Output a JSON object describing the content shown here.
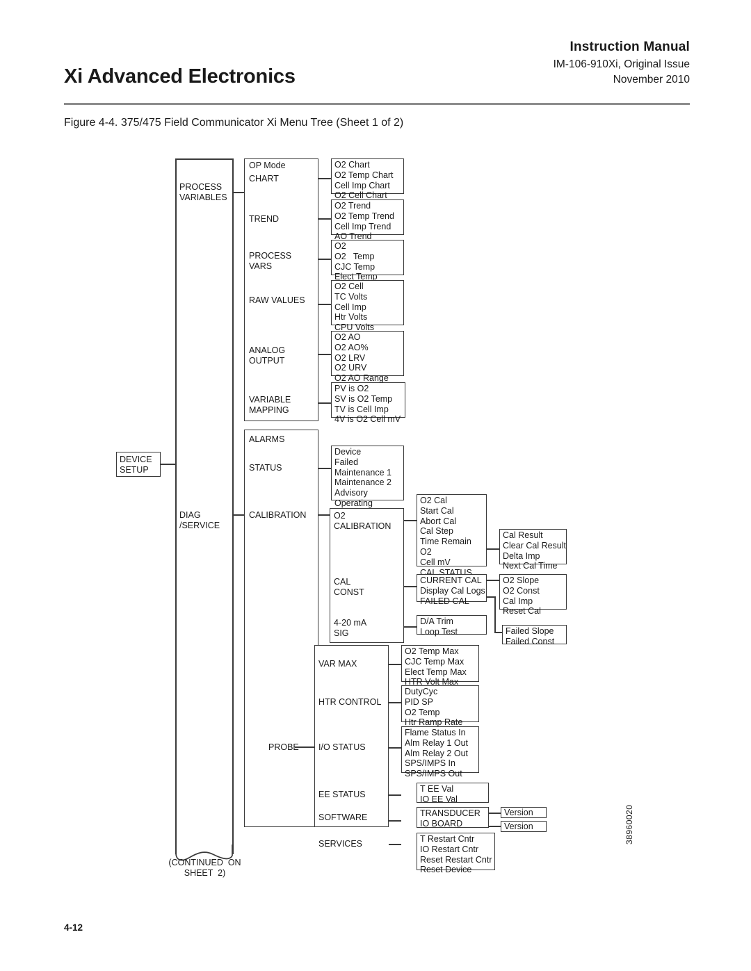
{
  "header": {
    "manual_label": "Instruction Manual",
    "doc_number": "IM-106-910Xi, Original Issue",
    "date": "November 2010",
    "product_title": "Xi Advanced Electronics",
    "figure_caption": "Figure 4-4. 375/475 Field Communicator Xi Menu Tree (Sheet 1 of 2)"
  },
  "footer": {
    "page_number": "4-12",
    "drawing_number": "38960020"
  },
  "tree": {
    "root": "DEVICE\nSETUP",
    "continued": "(CONTINUED  ON\nSHEET  2)",
    "branch_process_variables": "PROCESS\nVARIABLES",
    "branch_diag_service": "DIAG\n/SERVICE",
    "pv_items": {
      "op_mode": "OP Mode",
      "chart": "CHART",
      "trend": "TREND",
      "process_vars": "PROCESS\nVARS",
      "raw_values": "RAW VALUES",
      "analog_output": "ANALOG\nOUTPUT",
      "variable_mapping": "VARIABLE\nMAPPING"
    },
    "pv_leaves": {
      "chart": "O2 Chart\nO2 Temp Chart\nCell Imp Chart\nO2 Cell Chart",
      "trend": "O2 Trend\nO2 Temp Trend\nCell Imp Trend\nAO Trend",
      "process_vars": "O2\nO2   Temp\nCJC Temp\nElect Temp",
      "raw_values": "O2 Cell\nTC Volts\nCell Imp\nHtr Volts\nCPU Volts",
      "analog_output": "O2 AO\nO2 AO%\nO2 LRV\nO2 URV\nO2 AO Range",
      "variable_mapping": "PV is O2\nSV is O2 Temp\nTV is Cell Imp\n4V is O2 Cell mV"
    },
    "diag_items": {
      "alarms": "ALARMS",
      "status": "STATUS",
      "calibration": "CALIBRATION",
      "probe": "PROBE"
    },
    "diag_leaves": {
      "status": "Device\nFailed\nMaintenance 1\nMaintenance 2\nAdvisory\nOperating"
    },
    "calibration_items": {
      "o2_calibration": "O2\nCALIBRATION",
      "cal_const": "CAL\nCONST",
      "ma_sig": "4-20 mA\nSIG"
    },
    "calibration_leaves": {
      "o2_cal": "O2 Cal\nStart Cal\nAbort Cal\nCal Step\nTime Remain\nO2\nCell mV\nCAL STATUS",
      "cal_status": "Cal Result\nClear Cal Result\nDelta Imp\nNext Cal Time",
      "cal_const": "CURRENT CAL\nDisplay Cal Logs\nFAILED CAL",
      "current_cal": "O2 Slope\nO2 Const\nCal Imp\nReset Cal",
      "failed_cal": "Failed Slope\nFailed Const",
      "ma_sig": "D/A Trim\nLoop Test"
    },
    "probe_items": {
      "var_max": "VAR MAX",
      "htr_control": "HTR CONTROL",
      "io_status": "I/O STATUS",
      "ee_status": "EE STATUS",
      "software": "SOFTWARE",
      "services": "SERVICES"
    },
    "probe_leaves": {
      "var_max": "O2 Temp Max\nCJC Temp Max\nElect Temp Max\nHTR Volt Max",
      "htr_control": "DutyCyc\nPID SP\nO2 Temp\nHtr Ramp Rate",
      "io_status": "Flame Status In\nAlm Relay 1 Out\nAlm Relay 2 Out\nSPS/IMPS In\nSPS/IMPS Out",
      "ee_status": "T EE Val\nIO EE Val",
      "software": "TRANSDUCER\nIO BOARD",
      "transducer_version": "Version",
      "io_board_version": "Version",
      "services": "T Restart Cntr\nIO Restart Cntr\nReset Restart Cntr\nReset Device"
    }
  }
}
